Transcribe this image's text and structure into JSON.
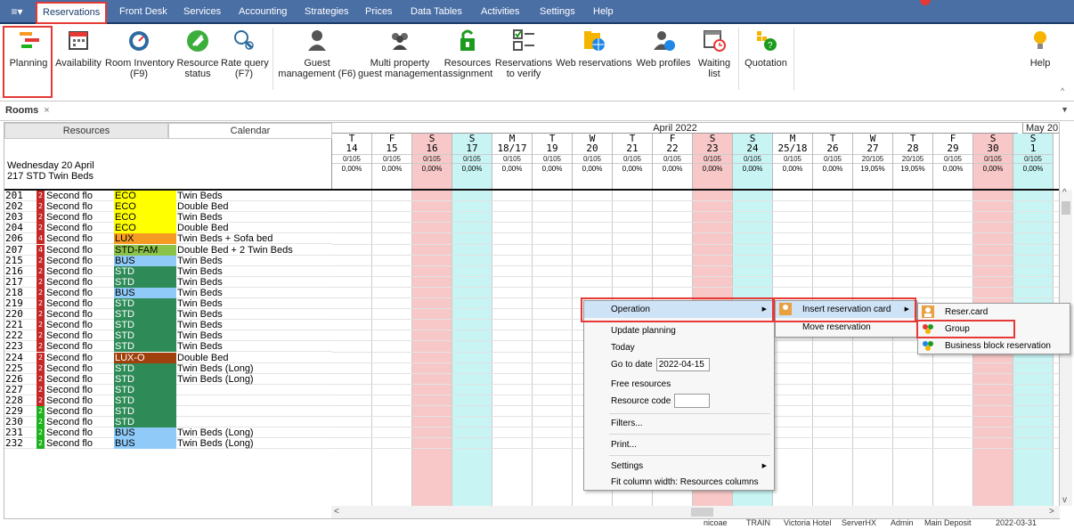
{
  "menubar": {
    "app_icon": "≡▾",
    "tabs": [
      "Reservations",
      "Front Desk",
      "Services",
      "Accounting",
      "Strategies",
      "Prices",
      "Data Tables",
      "Activities",
      "Settings",
      "Help"
    ],
    "active_tab": "Reservations"
  },
  "ribbon": {
    "buttons": [
      {
        "name": "planning",
        "label": "Planning",
        "sub": "",
        "icon": "planning-icon"
      },
      {
        "name": "availability",
        "label": "Availability",
        "sub": "",
        "icon": "calendar-icon"
      },
      {
        "name": "room-inventory",
        "label": "Room Inventory",
        "sub": "(F9)",
        "icon": "gauge-icon"
      },
      {
        "name": "resource-status",
        "label": "Resource",
        "sub": "status",
        "icon": "broom-icon"
      },
      {
        "name": "rate-query",
        "label": "Rate query",
        "sub": "(F7)",
        "icon": "search-user-icon"
      },
      {
        "name": "guest-management",
        "label": "Guest",
        "sub": "management (F6)",
        "icon": "person-icon"
      },
      {
        "name": "multi-property",
        "label": "Multi property",
        "sub": "guest management",
        "icon": "group-icon"
      },
      {
        "name": "resources-assignment",
        "label": "Resources",
        "sub": "assignment",
        "icon": "lock-icon"
      },
      {
        "name": "reservations-verify",
        "label": "Reservations",
        "sub": "to verify",
        "icon": "checklist-icon"
      },
      {
        "name": "web-reservations",
        "label": "Web reservations",
        "sub": "",
        "icon": "web-folder-icon"
      },
      {
        "name": "web-profiles",
        "label": "Web profiles",
        "sub": "",
        "icon": "web-profile-icon"
      },
      {
        "name": "waiting-list",
        "label": "Waiting",
        "sub": "list",
        "icon": "calendar-clock-icon"
      },
      {
        "name": "quotation",
        "label": "Quotation",
        "sub": "",
        "icon": "quotation-icon"
      },
      {
        "name": "help",
        "label": "Help",
        "sub": "",
        "icon": "lightbulb-icon"
      }
    ]
  },
  "doc_tab": {
    "label": "Rooms",
    "close": "×"
  },
  "left_header": {
    "resources_tab": "Resources",
    "calendar_tab": "Calendar",
    "date_line1": "Wednesday 20 April",
    "date_line2": "217 STD Twin Beds"
  },
  "calendar": {
    "month_label": "April 2022",
    "next_month_label": "May 20",
    "days": [
      {
        "dow": "T",
        "day": "14",
        "occ": "0/105",
        "pct": "0,00%",
        "kind": "normal"
      },
      {
        "dow": "F",
        "day": "15",
        "occ": "0/105",
        "pct": "0,00%",
        "kind": "normal"
      },
      {
        "dow": "S",
        "day": "16",
        "occ": "0/105",
        "pct": "0,00%",
        "kind": "sat"
      },
      {
        "dow": "S",
        "day": "17",
        "occ": "0/105",
        "pct": "0,00%",
        "kind": "sun"
      },
      {
        "dow": "M",
        "day": "18/17",
        "occ": "0/105",
        "pct": "0,00%",
        "kind": "normal"
      },
      {
        "dow": "T",
        "day": "19",
        "occ": "0/105",
        "pct": "0,00%",
        "kind": "normal"
      },
      {
        "dow": "W",
        "day": "20",
        "occ": "0/105",
        "pct": "0,00%",
        "kind": "normal"
      },
      {
        "dow": "T",
        "day": "21",
        "occ": "0/105",
        "pct": "0,00%",
        "kind": "normal"
      },
      {
        "dow": "F",
        "day": "22",
        "occ": "0/105",
        "pct": "0,00%",
        "kind": "normal"
      },
      {
        "dow": "S",
        "day": "23",
        "occ": "0/105",
        "pct": "0,00%",
        "kind": "sat"
      },
      {
        "dow": "S",
        "day": "24",
        "occ": "0/105",
        "pct": "0,00%",
        "kind": "sun"
      },
      {
        "dow": "M",
        "day": "25/18",
        "occ": "0/105",
        "pct": "0,00%",
        "kind": "normal"
      },
      {
        "dow": "T",
        "day": "26",
        "occ": "0/105",
        "pct": "0,00%",
        "kind": "normal"
      },
      {
        "dow": "W",
        "day": "27",
        "occ": "20/105",
        "pct": "19,05%",
        "kind": "normal"
      },
      {
        "dow": "T",
        "day": "28",
        "occ": "20/105",
        "pct": "19,05%",
        "kind": "normal"
      },
      {
        "dow": "F",
        "day": "29",
        "occ": "0/105",
        "pct": "0,00%",
        "kind": "normal"
      },
      {
        "dow": "S",
        "day": "30",
        "occ": "0/105",
        "pct": "0,00%",
        "kind": "sat"
      },
      {
        "dow": "S",
        "day": "1",
        "occ": "0/105",
        "pct": "0,00%",
        "kind": "sun"
      }
    ]
  },
  "rooms": [
    {
      "num": "201",
      "floor": "2",
      "fcolor": "#c62828",
      "level": "Second flo",
      "cat": "ECO",
      "ccolor": "#ffff00",
      "type": "Twin Beds"
    },
    {
      "num": "202",
      "floor": "2",
      "fcolor": "#c62828",
      "level": "Second flo",
      "cat": "ECO",
      "ccolor": "#ffff00",
      "type": "Double Bed"
    },
    {
      "num": "203",
      "floor": "2",
      "fcolor": "#c62828",
      "level": "Second flo",
      "cat": "ECO",
      "ccolor": "#ffff00",
      "type": "Twin Beds"
    },
    {
      "num": "204",
      "floor": "2",
      "fcolor": "#c62828",
      "level": "Second flo",
      "cat": "ECO",
      "ccolor": "#ffff00",
      "type": "Double Bed"
    },
    {
      "num": "206",
      "floor": "4",
      "fcolor": "#c62828",
      "level": "Second flo",
      "cat": "LUX",
      "ccolor": "#f59a23",
      "type": "Twin Beds + Sofa bed"
    },
    {
      "num": "207",
      "floor": "4",
      "fcolor": "#c62828",
      "level": "Second flo",
      "cat": "STD-FAM",
      "ccolor": "#8bc34a",
      "type": "Double Bed + 2 Twin Beds"
    },
    {
      "num": "215",
      "floor": "2",
      "fcolor": "#c62828",
      "level": "Second flo",
      "cat": "BUS",
      "ccolor": "#90caf9",
      "type": "Twin Beds"
    },
    {
      "num": "216",
      "floor": "2",
      "fcolor": "#c62828",
      "level": "Second flo",
      "cat": "STD",
      "ccolor": "#2e8b57",
      "type": "Twin Beds"
    },
    {
      "num": "217",
      "floor": "2",
      "fcolor": "#c62828",
      "level": "Second flo",
      "cat": "STD",
      "ccolor": "#2e8b57",
      "type": "Twin Beds"
    },
    {
      "num": "218",
      "floor": "2",
      "fcolor": "#c62828",
      "level": "Second flo",
      "cat": "BUS",
      "ccolor": "#90caf9",
      "type": "Twin Beds"
    },
    {
      "num": "219",
      "floor": "2",
      "fcolor": "#c62828",
      "level": "Second flo",
      "cat": "STD",
      "ccolor": "#2e8b57",
      "type": "Twin Beds"
    },
    {
      "num": "220",
      "floor": "2",
      "fcolor": "#c62828",
      "level": "Second flo",
      "cat": "STD",
      "ccolor": "#2e8b57",
      "type": "Twin Beds"
    },
    {
      "num": "221",
      "floor": "2",
      "fcolor": "#c62828",
      "level": "Second flo",
      "cat": "STD",
      "ccolor": "#2e8b57",
      "type": "Twin Beds"
    },
    {
      "num": "222",
      "floor": "2",
      "fcolor": "#c62828",
      "level": "Second flo",
      "cat": "STD",
      "ccolor": "#2e8b57",
      "type": "Twin Beds"
    },
    {
      "num": "223",
      "floor": "2",
      "fcolor": "#c62828",
      "level": "Second flo",
      "cat": "STD",
      "ccolor": "#2e8b57",
      "type": "Twin Beds"
    },
    {
      "num": "224",
      "floor": "2",
      "fcolor": "#c62828",
      "level": "Second flo",
      "cat": "LUX-O",
      "ccolor": "#a0400c",
      "type": "Double Bed"
    },
    {
      "num": "225",
      "floor": "2",
      "fcolor": "#c62828",
      "level": "Second flo",
      "cat": "STD",
      "ccolor": "#2e8b57",
      "type": "Twin Beds (Long)"
    },
    {
      "num": "226",
      "floor": "2",
      "fcolor": "#c62828",
      "level": "Second flo",
      "cat": "STD",
      "ccolor": "#2e8b57",
      "type": "Twin Beds (Long)"
    },
    {
      "num": "227",
      "floor": "2",
      "fcolor": "#c62828",
      "level": "Second flo",
      "cat": "STD",
      "ccolor": "#2e8b57",
      "type": ""
    },
    {
      "num": "228",
      "floor": "2",
      "fcolor": "#c62828",
      "level": "Second flo",
      "cat": "STD",
      "ccolor": "#2e8b57",
      "type": ""
    },
    {
      "num": "229",
      "floor": "2",
      "fcolor": "#1db31d",
      "level": "Second flo",
      "cat": "STD",
      "ccolor": "#2e8b57",
      "type": ""
    },
    {
      "num": "230",
      "floor": "2",
      "fcolor": "#1db31d",
      "level": "Second flo",
      "cat": "STD",
      "ccolor": "#2e8b57",
      "type": ""
    },
    {
      "num": "231",
      "floor": "2",
      "fcolor": "#1db31d",
      "level": "Second flo",
      "cat": "BUS",
      "ccolor": "#90caf9",
      "type": "Twin Beds (Long)"
    },
    {
      "num": "232",
      "floor": "2",
      "fcolor": "#1db31d",
      "level": "Second flo",
      "cat": "BUS",
      "ccolor": "#90caf9",
      "type": "Twin Beds (Long)"
    }
  ],
  "context_menu": {
    "items": [
      {
        "label": "Operation",
        "has_sub": true
      },
      {
        "label": "Update planning"
      },
      {
        "label": "Today"
      },
      {
        "label": "Go to date",
        "input": "2022-04-15"
      },
      {
        "label": "Free resources"
      },
      {
        "label": "Resource code",
        "input": ""
      },
      {
        "label": "Filters..."
      },
      {
        "label": "Print..."
      },
      {
        "label": "Settings",
        "has_sub": true
      },
      {
        "label": "Fit column width: Resources columns"
      }
    ]
  },
  "operation_submenu": {
    "items": [
      {
        "label": "Insert reservation card",
        "has_sub": true
      },
      {
        "label": "Move reservation"
      }
    ]
  },
  "insert_submenu": {
    "items": [
      {
        "label": "Reser.card",
        "icon": "reservation-card-icon"
      },
      {
        "label": "Group",
        "icon": "group-icon"
      },
      {
        "label": "Business block reservation",
        "icon": "business-block-icon"
      }
    ]
  },
  "statusbar": {
    "user": "nicoae",
    "mode": "TRAIN",
    "hotel": "Victoria Hotel",
    "server": "ServerHX",
    "admin": "Admin",
    "deposit": "Main Deposit",
    "date": "2022-03-31"
  },
  "colors": {
    "menubar": "#4a6fa5",
    "saturday": "#f8c8c8",
    "sunday": "#c8f4f4",
    "highlight_red": "#e53935"
  }
}
